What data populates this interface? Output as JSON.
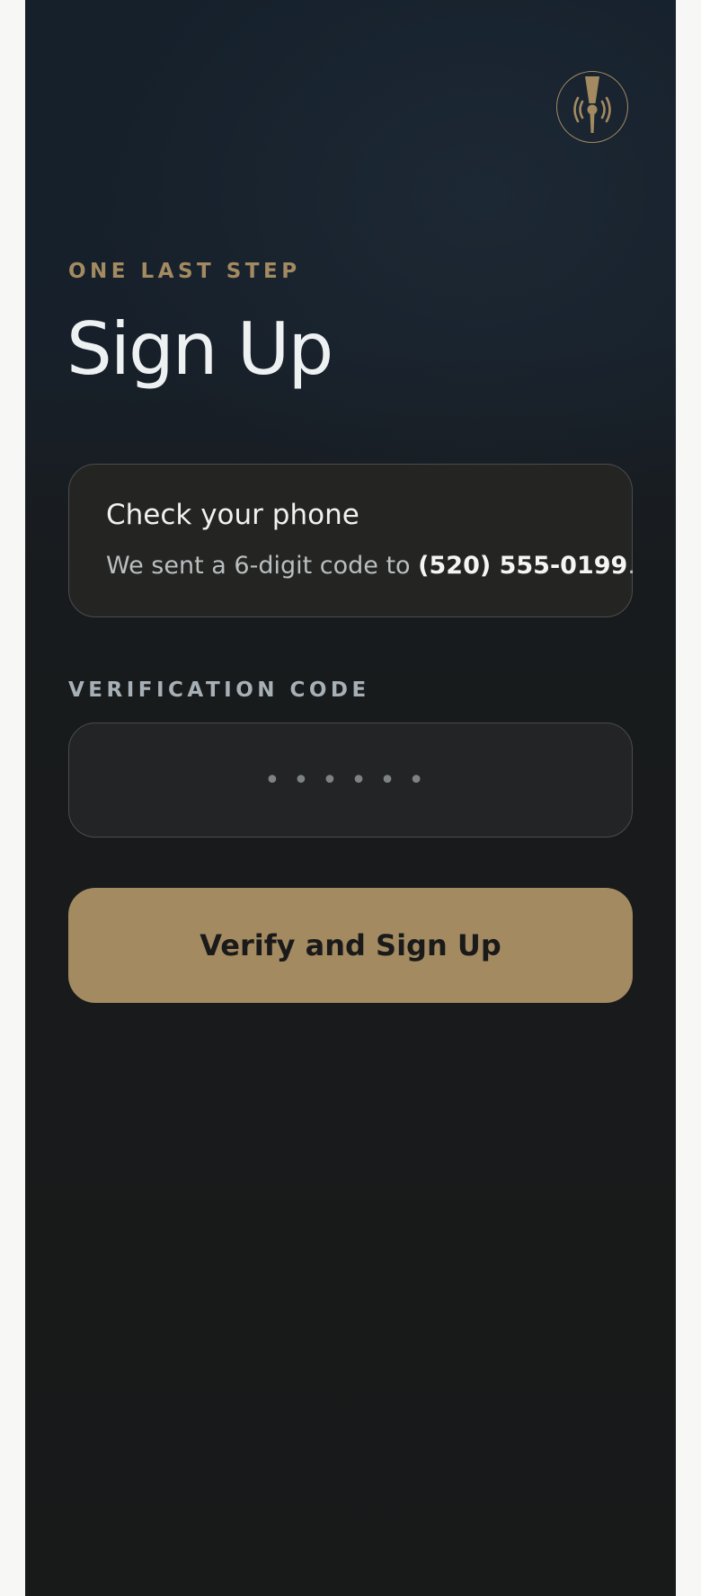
{
  "header": {
    "logo_icon": "beer-tap-icon"
  },
  "intro": {
    "eyebrow": "ONE LAST STEP",
    "title": "Sign Up"
  },
  "notice": {
    "title": "Check your phone",
    "message_prefix": "We sent a 6-digit code to ",
    "phone": "(520) 555-0199",
    "message_suffix": "."
  },
  "verification": {
    "label": "VERIFICATION CODE",
    "value": "",
    "placeholder": "••••••"
  },
  "actions": {
    "submit_label": "Verify and Sign Up"
  },
  "colors": {
    "accent": "#a38a61",
    "background": "#181919",
    "text": "#eef1f2"
  }
}
